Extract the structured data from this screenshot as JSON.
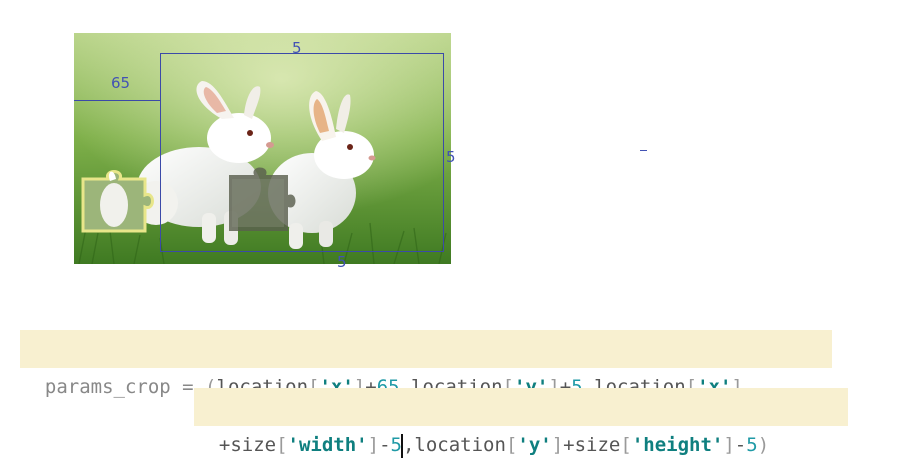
{
  "image": {
    "description_icon": "rabbit-captcha-image",
    "annotations": {
      "top_label": "5",
      "left_label": "65",
      "right_label": "5",
      "bottom_label": "5"
    },
    "colors": {
      "annotation": "#3b4aa8"
    }
  },
  "code": {
    "line1": [
      {
        "t": "params_crop = ",
        "k": "name"
      },
      {
        "t": "(",
        "k": "bracket"
      },
      {
        "t": "location",
        "k": "plain"
      },
      {
        "t": "[",
        "k": "bracket"
      },
      {
        "t": "'x'",
        "k": "str"
      },
      {
        "t": "]",
        "k": "bracket"
      },
      {
        "t": "+",
        "k": "plain"
      },
      {
        "t": "65",
        "k": "num"
      },
      {
        "t": ",location",
        "k": "plain"
      },
      {
        "t": "[",
        "k": "bracket"
      },
      {
        "t": "'y'",
        "k": "str"
      },
      {
        "t": "]",
        "k": "bracket"
      },
      {
        "t": "+",
        "k": "plain"
      },
      {
        "t": "5",
        "k": "num"
      },
      {
        "t": ",location",
        "k": "plain"
      },
      {
        "t": "[",
        "k": "bracket"
      },
      {
        "t": "'x'",
        "k": "str"
      },
      {
        "t": "]",
        "k": "bracket"
      }
    ],
    "line2": [
      {
        "t": "+size",
        "k": "plain"
      },
      {
        "t": "[",
        "k": "bracket"
      },
      {
        "t": "'width'",
        "k": "str"
      },
      {
        "t": "]",
        "k": "bracket"
      },
      {
        "t": "-",
        "k": "plain"
      },
      {
        "t": "5",
        "k": "num"
      },
      {
        "t": "|caret|",
        "k": "caret"
      },
      {
        "t": ",location",
        "k": "plain"
      },
      {
        "t": "[",
        "k": "bracket"
      },
      {
        "t": "'y'",
        "k": "str"
      },
      {
        "t": "]",
        "k": "bracket"
      },
      {
        "t": "+size",
        "k": "plain"
      },
      {
        "t": "[",
        "k": "bracket"
      },
      {
        "t": "'height'",
        "k": "str"
      },
      {
        "t": "]",
        "k": "bracket"
      },
      {
        "t": "-",
        "k": "plain"
      },
      {
        "t": "5",
        "k": "num"
      },
      {
        "t": ")",
        "k": "bracket"
      }
    ]
  }
}
